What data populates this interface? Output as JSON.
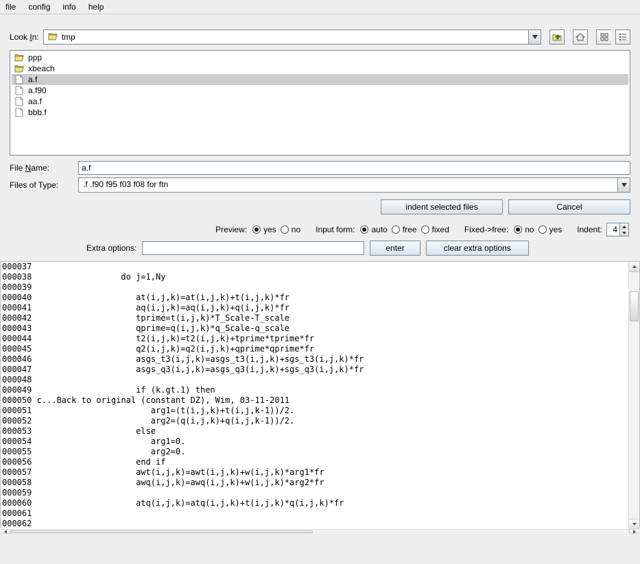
{
  "menu": {
    "file": "file",
    "config": "config",
    "info": "info",
    "help": "help"
  },
  "lookin": {
    "label": "Look In:",
    "value": "tmp"
  },
  "files": [
    {
      "name": "ppp",
      "icon": "folder-open",
      "selected": false
    },
    {
      "name": "xbeach",
      "icon": "folder-open",
      "selected": false
    },
    {
      "name": "a.f",
      "icon": "file",
      "selected": true
    },
    {
      "name": "a.f90",
      "icon": "file",
      "selected": false
    },
    {
      "name": "aa.f",
      "icon": "file",
      "selected": false
    },
    {
      "name": "bbb.f",
      "icon": "file",
      "selected": false
    }
  ],
  "fname": {
    "label": "File Name:",
    "value": "a.f"
  },
  "ftype": {
    "label": "Files of Type:",
    "value": ".f .f90 f95 f03 f08 for ftn"
  },
  "actions": {
    "indent": "indent selected files",
    "cancel": "Cancel"
  },
  "opts": {
    "preview_label": "Preview:",
    "yes": "yes",
    "no": "no",
    "input_label": "Input form:",
    "auto": "auto",
    "free": "free",
    "fixed": "fixed",
    "f2f_label": "Fixed->free:",
    "indent_label": "Indent:",
    "indent_value": "4"
  },
  "extra": {
    "label": "Extra options:",
    "value": "",
    "enter": "enter",
    "clear": "clear extra options"
  },
  "code": "000037\n000038                  do j=1,Ny\n000039\n000040                     at(i,j,k)=at(i,j,k)+t(i,j,k)*fr\n000041                     aq(i,j,k)=aq(i,j,k)+q(i,j,k)*fr\n000042                     tprime=t(i,j,k)*T_Scale-T_scale\n000043                     qprime=q(i,j,k)*q_Scale-q_scale\n000044                     t2(i,j,k)=t2(i,j,k)+tprime*tprime*fr\n000045                     q2(i,j,k)=q2(i,j,k)+qprime*qprime*fr\n000046                     asgs_t3(i,j,k)=asgs_t3(i,j,k)+sgs_t3(i,j,k)*fr\n000047                     asgs_q3(i,j,k)=asgs_q3(i,j,k)+sgs_q3(i,j,k)*fr\n000048\n000049                     if (k.gt.1) then\n000050 c...Back to original (constant DZ), Wim, 03-11-2011\n000051                        arg1=(t(i,j,k)+t(i,j,k-1))/2.\n000052                        arg2=(q(i,j,k)+q(i,j,k-1))/2.\n000053                     else\n000054                        arg1=0.\n000055                        arg2=0.\n000056                     end if\n000057                     awt(i,j,k)=awt(i,j,k)+w(i,j,k)*arg1*fr\n000058                     awq(i,j,k)=awq(i,j,k)+w(i,j,k)*arg2*fr\n000059\n000060                     atq(i,j,k)=atq(i,j,k)+t(i,j,k)*q(i,j,k)*fr\n000061\n000062"
}
